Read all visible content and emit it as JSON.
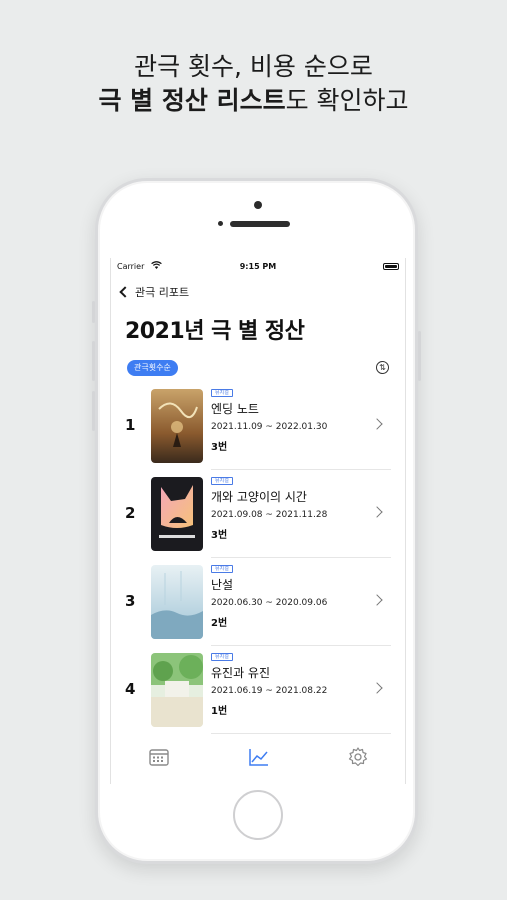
{
  "headline": {
    "line1": "관극 횟수, 비용 순으로",
    "line2_bold": "극 별 정산 리스트",
    "line2_rest": "도 확인하고"
  },
  "status_bar": {
    "carrier": "Carrier",
    "time": "9:15 PM"
  },
  "nav": {
    "back_label": "관극 리포트"
  },
  "page": {
    "title": "2021년 극 별 정산",
    "sort_chip": "관극횟수순",
    "sort_icon": "sort-toggle-icon"
  },
  "plays": [
    {
      "rank": "1",
      "badge": "뮤지컬",
      "name": "엔딩 노트",
      "dates": "2021.11.09 ~ 2022.01.30",
      "count": "3번"
    },
    {
      "rank": "2",
      "badge": "뮤지컬",
      "name": "개와 고양이의 시간",
      "dates": "2021.09.08 ~ 2021.11.28",
      "count": "3번"
    },
    {
      "rank": "3",
      "badge": "뮤지컬",
      "name": "난설",
      "dates": "2020.06.30 ~ 2020.09.06",
      "count": "2번"
    },
    {
      "rank": "4",
      "badge": "뮤지컬",
      "name": "유진과 유진",
      "dates": "2021.06.19 ~ 2021.08.22",
      "count": "1번"
    }
  ],
  "tabbar": {
    "items": [
      {
        "icon": "calendar-icon",
        "active": false
      },
      {
        "icon": "chart-line-icon",
        "active": true
      },
      {
        "icon": "gear-icon",
        "active": false
      }
    ],
    "active_color": "#3e7df2",
    "inactive_color": "#8a8a8a"
  },
  "colors": {
    "accent": "#3e7df2",
    "background": "#eaecec"
  }
}
